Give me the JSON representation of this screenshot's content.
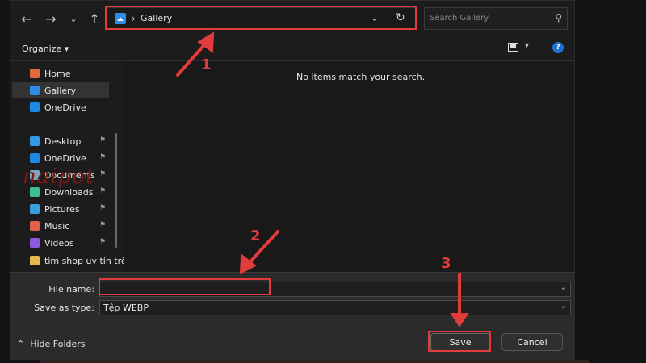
{
  "address_bar": {
    "current_location": "Gallery"
  },
  "search": {
    "placeholder": "Search Gallery"
  },
  "command_bar": {
    "organize_label": "Organize"
  },
  "sidebar": {
    "items": [
      {
        "label": "Home",
        "icon": "home-icon",
        "color": "#e06b3a",
        "pinned": false,
        "selected": false
      },
      {
        "label": "Gallery",
        "icon": "gallery-icon",
        "color": "#2f8be6",
        "pinned": false,
        "selected": true
      },
      {
        "label": "OneDrive",
        "icon": "onedrive-icon",
        "color": "#1e88e5",
        "pinned": false,
        "selected": false
      },
      {
        "label": "Desktop",
        "icon": "desktop-icon",
        "color": "#2f9be6",
        "pinned": true,
        "selected": false
      },
      {
        "label": "OneDrive",
        "icon": "onedrive-icon",
        "color": "#1e88e5",
        "pinned": true,
        "selected": false
      },
      {
        "label": "Documents",
        "icon": "documents-icon",
        "color": "#7aa7c7",
        "pinned": true,
        "selected": false
      },
      {
        "label": "Downloads",
        "icon": "downloads-icon",
        "color": "#3bbf8c",
        "pinned": true,
        "selected": false
      },
      {
        "label": "Pictures",
        "icon": "pictures-icon",
        "color": "#3a9de0",
        "pinned": true,
        "selected": false
      },
      {
        "label": "Music",
        "icon": "music-icon",
        "color": "#e0604a",
        "pinned": true,
        "selected": false
      },
      {
        "label": "Videos",
        "icon": "videos-icon",
        "color": "#8c5ae0",
        "pinned": true,
        "selected": false
      },
      {
        "label": "tìm shop uy tín trê",
        "icon": "folder-icon",
        "color": "#e8b84a",
        "pinned": false,
        "selected": false
      }
    ],
    "watermark": "naipot"
  },
  "content": {
    "empty_message": "No items match your search."
  },
  "save_panel": {
    "file_name_label": "File name:",
    "file_name_value": "",
    "save_type_label": "Save as type:",
    "save_type_value": "Tệp WEBP",
    "hide_folders_label": "Hide Folders",
    "save_label": "Save",
    "cancel_label": "Cancel"
  },
  "annotations": {
    "step1": "1",
    "step2": "2",
    "step3": "3",
    "color": "#e23b3b"
  }
}
